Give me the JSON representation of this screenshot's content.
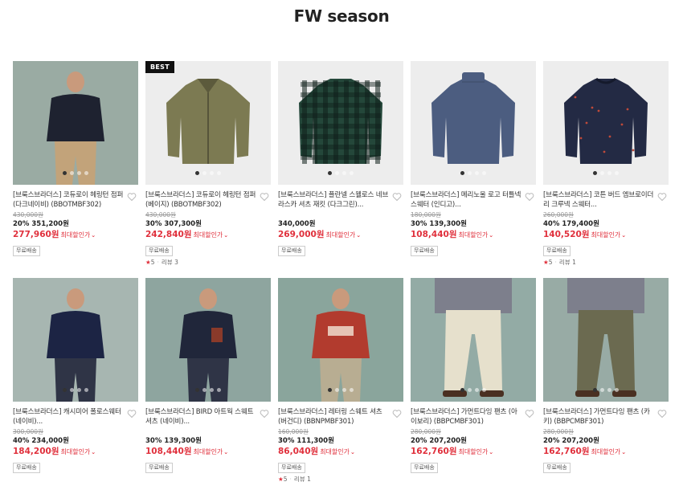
{
  "page_title": "FW season",
  "max_discount_label": "최대할인가",
  "products": [
    {
      "name": "[브룩스브라더스] 코듀로이 헤링턴 점퍼 (다크네이비) (BBOTMBF302)",
      "original_price": "430,000원",
      "discount_pct": "20%",
      "sale_price": "351,200원",
      "max_price": "277,960원",
      "badge": "무료배송",
      "best": false,
      "rating": "",
      "review": "",
      "bg": "#9aaba3",
      "item": "#1e2230",
      "item_kind": "person-dark",
      "dots": 4,
      "active_dot": 0
    },
    {
      "name": "[브룩스브라더스] 코듀로이 헤링턴 점퍼 (베이지) (BBOTMBF302)",
      "original_price": "430,000원",
      "discount_pct": "30%",
      "sale_price": "307,300원",
      "max_price": "242,840원",
      "badge": "무료배송",
      "best": true,
      "best_label": "BEST",
      "rating": "5",
      "review": "리뷰 3",
      "bg": "#ededed",
      "item": "#7c7a52",
      "item_kind": "jacket",
      "dots": 4,
      "active_dot": 0
    },
    {
      "name": "[브룩스브라더스] 플란넬 스웰로스 네브라스카 셔츠 재킷 (다크그린)...",
      "original_price": "",
      "discount_pct": "",
      "sale_price": "340,000원",
      "max_price": "269,000원",
      "badge": "무료배송",
      "best": false,
      "rating": "",
      "review": "",
      "bg": "#ededed",
      "item": "#24473a",
      "item_kind": "plaid",
      "dots": 4,
      "active_dot": 0
    },
    {
      "name": "[브룩스브라더스] 메리노울 로고 터틀넥 스웨터 (인디고)...",
      "original_price": "180,000원",
      "discount_pct": "30%",
      "sale_price": "139,300원",
      "max_price": "108,440원",
      "badge": "무료배송",
      "best": false,
      "rating": "",
      "review": "",
      "bg": "#ededed",
      "item": "#4c5d80",
      "item_kind": "turtleneck",
      "dots": 4,
      "active_dot": 0
    },
    {
      "name": "[브룩스브라더스] 코튼 버드 엠브로이더리 크루넥 스웨터...",
      "original_price": "260,000원",
      "discount_pct": "40%",
      "sale_price": "179,400원",
      "max_price": "140,520원",
      "badge": "무료배송",
      "best": false,
      "rating": "5",
      "review": "리뷰 1",
      "bg": "#ededed",
      "item": "#232a44",
      "item_kind": "crew",
      "dots": 4,
      "active_dot": 0
    },
    {
      "name": "[브룩스브라더스] 캐시미어 폴로스웨터 (네이비)...",
      "original_price": "300,000원",
      "discount_pct": "40%",
      "sale_price": "234,000원",
      "max_price": "184,200원",
      "badge": "무료배송",
      "best": false,
      "rating": "",
      "review": "",
      "bg": "#a7b6b1",
      "item": "#1c2444",
      "item_kind": "person-navy",
      "dots": 4,
      "active_dot": 0
    },
    {
      "name": "[브룩스브라더스] BIRD 아트웍 스웨트 셔츠 (네이비)...",
      "original_price": "",
      "discount_pct": "30%",
      "sale_price": "139,300원",
      "max_price": "108,440원",
      "badge": "무료배송",
      "best": false,
      "rating": "",
      "review": "",
      "bg": "#8ea59f",
      "item": "#20263a",
      "item_kind": "person-sweat",
      "dots": 4,
      "active_dot": 0
    },
    {
      "name": "[브룩스브라더스] 레터링 스웨트 셔츠 (버건디) (BBNPMBF301)",
      "original_price": "160,000원",
      "discount_pct": "30%",
      "sale_price": "111,300원",
      "max_price": "86,040원",
      "badge": "무료배송",
      "best": false,
      "rating": "5",
      "review": "리뷰 1",
      "bg": "#8aa59c",
      "item": "#b23b2e",
      "item_kind": "person-red",
      "dots": 4,
      "active_dot": 0
    },
    {
      "name": "[브룩스브라더스] 가먼트다잉 팬츠 (아이보리) (BBPCMBF301)",
      "original_price": "280,000원",
      "discount_pct": "20%",
      "sale_price": "207,200원",
      "max_price": "162,760원",
      "badge": "무료배송",
      "best": false,
      "rating": "",
      "review": "",
      "bg": "#93aba5",
      "item": "#e6e0cc",
      "item_kind": "pants-light",
      "dots": 4,
      "active_dot": 0
    },
    {
      "name": "[브룩스브라더스] 가먼트다잉 팬츠 (카키) (BBPCMBF301)",
      "original_price": "280,000원",
      "discount_pct": "20%",
      "sale_price": "207,200원",
      "max_price": "162,760원",
      "badge": "무료배송",
      "best": false,
      "rating": "",
      "review": "",
      "bg": "#98aba5",
      "item": "#6b6a50",
      "item_kind": "pants-khaki",
      "dots": 4,
      "active_dot": 0
    }
  ]
}
